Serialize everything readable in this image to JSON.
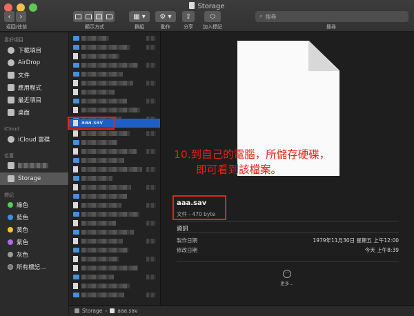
{
  "window": {
    "title": "Storage"
  },
  "toolbar": {
    "nav_label": "返回/往前",
    "view_label": "顯示方式",
    "group_label": "群組",
    "action_label": "動作",
    "share_label": "分享",
    "tag_label": "加入標記",
    "search_placeholder": "搜尋",
    "search_label": "搜尋"
  },
  "sidebar": {
    "favorites_header": "喜好項目",
    "favorites": [
      {
        "label": "下載項目",
        "icon": "download-icon"
      },
      {
        "label": "AirDrop",
        "icon": "airdrop-icon"
      },
      {
        "label": "文件",
        "icon": "document-icon"
      },
      {
        "label": "應用程式",
        "icon": "applications-icon"
      },
      {
        "label": "最近項目",
        "icon": "recents-icon"
      },
      {
        "label": "桌面",
        "icon": "desktop-icon"
      }
    ],
    "icloud_header": "iCloud",
    "icloud": [
      {
        "label": "iCloud 雲碟",
        "icon": "cloud-icon"
      }
    ],
    "locations_header": "位置",
    "locations": [
      {
        "label": "Storage",
        "icon": "disk-icon",
        "selected": true
      }
    ],
    "tags_header": "標記",
    "tags": [
      {
        "label": "綠色",
        "color": "#5cc85a"
      },
      {
        "label": "藍色",
        "color": "#3b8eea"
      },
      {
        "label": "黃色",
        "color": "#f4c430"
      },
      {
        "label": "紫色",
        "color": "#b46bdf"
      },
      {
        "label": "灰色",
        "color": "#9a9a9a"
      },
      {
        "label": "所有標記…",
        "color": "#777777"
      }
    ]
  },
  "filelist": {
    "selected_file": "aaa.sav"
  },
  "preview": {
    "annotation_line1": "10.到自己的電腦，所儲存硬碟，",
    "annotation_line2": "即可看到該檔案。",
    "file_name": "aaa.sav",
    "file_meta": "文件 - 470 byte",
    "info_header": "資訊",
    "created_label": "製作日期",
    "created_value": "1979年11月30日 星期五 上午12:00",
    "modified_label": "修改日期",
    "modified_value": "今天 上午8:39",
    "more_label": "更多…"
  },
  "pathbar": {
    "root": "Storage",
    "separator": "›",
    "file": "aaa.sav"
  },
  "colors": {
    "accent": "#1f5fc4",
    "annotation": "#e8201c"
  }
}
